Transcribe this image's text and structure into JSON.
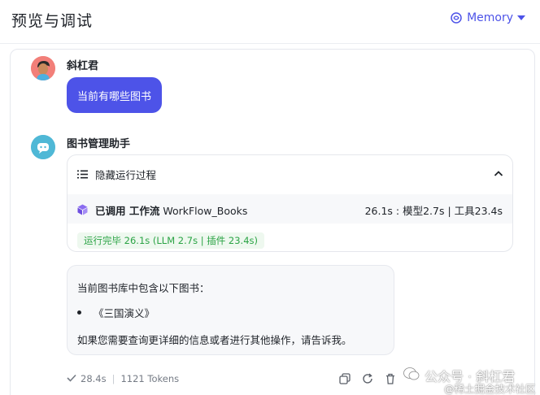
{
  "header": {
    "title": "预览与调试",
    "memory_label": "Memory",
    "accent_color": "#4d53e8"
  },
  "chat": {
    "user": {
      "name": "斜杠君",
      "message": "当前有哪些图书"
    },
    "bot": {
      "name": "图书管理助手",
      "process": {
        "toggle_label": "隐藏运行过程",
        "called_prefix": "已调用 工作流",
        "workflow_name": "WorkFlow_Books",
        "timing": "26.1s : 模型2.7s | 工具23.4s",
        "done_badge": "运行完毕 26.1s (LLM 2.7s | 插件 23.4s)",
        "done_color": "#2aa344"
      },
      "answer": {
        "intro": "当前图书库中包含以下图书：",
        "items": [
          "《三国演义》"
        ],
        "outro": "如果您需要查询更详细的信息或者进行其他操作，请告诉我。"
      },
      "footer": {
        "duration": "28.4s",
        "tokens": "1121 Tokens",
        "separator": "|"
      }
    }
  },
  "watermark": {
    "line1": "公众号 · 斜杠君",
    "line2": "@稀土掘金技术社区"
  },
  "icons": {
    "memory": "memory-brain-icon",
    "dropdown": "caret-down-icon",
    "list": "list-icon",
    "collapse": "chevron-up-icon",
    "workflow": "cube-icon",
    "check": "check-icon",
    "copy": "copy-icon",
    "regenerate": "refresh-icon",
    "delete": "trash-icon"
  }
}
